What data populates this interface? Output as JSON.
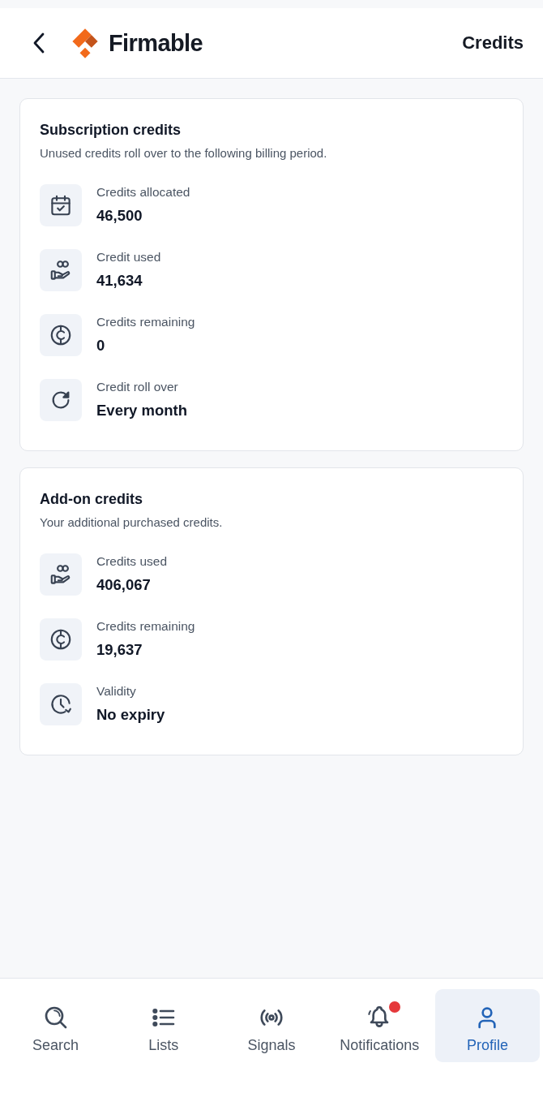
{
  "header": {
    "logo_text": "Firmable",
    "title": "Credits"
  },
  "sections": [
    {
      "title": "Subscription credits",
      "subtitle": "Unused credits roll over to the following billing period.",
      "items": [
        {
          "kind": "calendar",
          "label": "Credits allocated",
          "value": "46,500"
        },
        {
          "kind": "hand",
          "label": "Credit used",
          "value": "41,634"
        },
        {
          "kind": "coin",
          "label": "Credits remaining",
          "value": "0"
        },
        {
          "kind": "refresh",
          "label": "Credit roll over",
          "value": "Every month"
        }
      ]
    },
    {
      "title": "Add-on credits",
      "subtitle": "Your additional purchased credits.",
      "items": [
        {
          "kind": "hand",
          "label": "Credits used",
          "value": "406,067"
        },
        {
          "kind": "coin",
          "label": "Credits remaining",
          "value": "19,637"
        },
        {
          "kind": "clock",
          "label": "Validity",
          "value": "No expiry"
        }
      ]
    }
  ],
  "nav": [
    {
      "kind": "search",
      "label": "Search",
      "selected": false,
      "badge": false
    },
    {
      "kind": "list",
      "label": "Lists",
      "selected": false,
      "badge": false
    },
    {
      "kind": "signal",
      "label": "Signals",
      "selected": false,
      "badge": false
    },
    {
      "kind": "bell",
      "label": "Notifications",
      "selected": false,
      "badge": true
    },
    {
      "kind": "user",
      "label": "Profile",
      "selected": true,
      "badge": false
    }
  ]
}
